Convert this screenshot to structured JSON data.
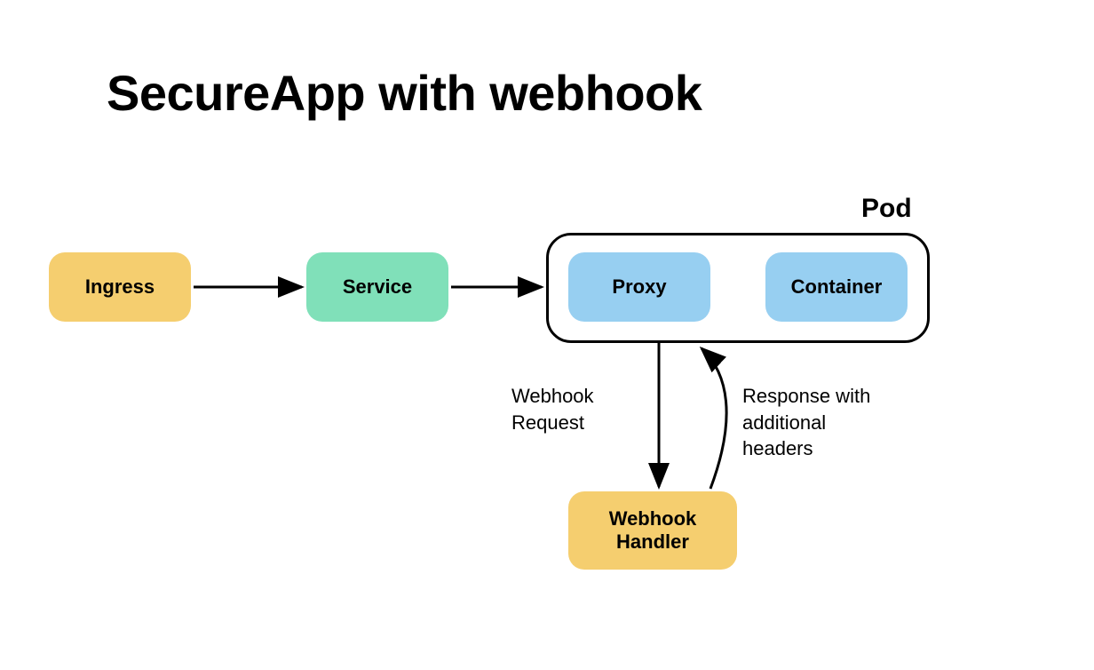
{
  "title": "SecureApp with webhook",
  "nodes": {
    "ingress": "Ingress",
    "service": "Service",
    "pod_label": "Pod",
    "proxy": "Proxy",
    "container": "Container",
    "webhook_handler": "Webhook\nHandler"
  },
  "edge_labels": {
    "webhook_request": "Webhook\nRequest",
    "response": "Response with\nadditional\nheaders"
  }
}
